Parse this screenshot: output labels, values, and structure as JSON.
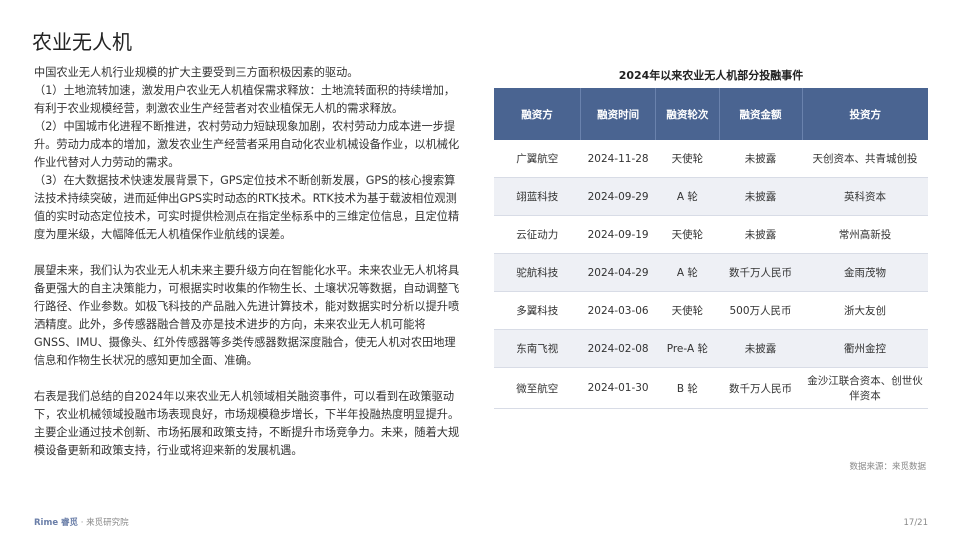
{
  "page": {
    "title": "农业无人机",
    "page_number": "17/21"
  },
  "body": {
    "intro": "中国农业无人机行业规模的扩大主要受到三方面积极因素的驱动。",
    "points": [
      "（1）土地流转加速，激发用户农业无人机植保需求释放：土地流转面积的持续增加，有利于农业规模经营，刺激农业生产经营者对农业植保无人机的需求释放。",
      "（2）中国城市化进程不断推进，农村劳动力短缺现象加剧，农村劳动力成本进一步提升。劳动力成本的增加，激发农业生产经营者采用自动化农业机械设备作业，以机械化作业代替对人力劳动的需求。",
      "（3）在大数据技术快速发展背景下，GPS定位技术不断创新发展，GPS的核心搜索算法技术持续突破，进而延伸出GPS实时动态的RTK技术。RTK技术为基于载波相位观测值的实时动态定位技术，可实时提供检测点在指定坐标系中的三维定位信息，且定位精度为厘米级，大幅降低无人机植保作业航线的误差。"
    ],
    "outlook": "展望未来，我们认为农业无人机未来主要升级方向在智能化水平。未来农业无人机将具备更强大的自主决策能力，可根据实时收集的作物生长、土壤状况等数据，自动调整飞行路径、作业参数。如极飞科技的产品融入先进计算技术，能对数据实时分析以提升喷洒精度。此外，多传感器融合普及亦是技术进步的方向，未来农业无人机可能将GNSS、IMU、摄像头、红外传感器等多类传感器数据深度融合，使无人机对农田地理信息和作物生长状况的感知更加全面、准确。",
    "summary": "右表是我们总结的自2024年以来农业无人机领域相关融资事件，可以看到在政策驱动下，农业机械领域投融市场表现良好，市场规模稳步增长，下半年投融热度明显提升。主要企业通过技术创新、市场拓展和政策支持，不断提升市场竞争力。未来，随着大规模设备更新和政策支持，行业或将迎来新的发展机遇。"
  },
  "table": {
    "title": "2024年以来农业无人机部分投融事件",
    "headers": [
      "融资方",
      "融资时间",
      "融资轮次",
      "融资金额",
      "投资方"
    ],
    "rows": [
      [
        "广翼航空",
        "2024-11-28",
        "天使轮",
        "未披露",
        "天创资本、共青城创投"
      ],
      [
        "翊蓝科技",
        "2024-09-29",
        "A 轮",
        "未披露",
        "英科资本"
      ],
      [
        "云征动力",
        "2024-09-19",
        "天使轮",
        "未披露",
        "常州高新投"
      ],
      [
        "驼航科技",
        "2024-04-29",
        "A 轮",
        "数千万人民币",
        "金雨茂物"
      ],
      [
        "多翼科技",
        "2024-03-06",
        "天使轮",
        "500万人民币",
        "浙大友创"
      ],
      [
        "东南飞视",
        "2024-02-08",
        "Pre-A 轮",
        "未披露",
        "衢州金控"
      ],
      [
        "微至航空",
        "2024-01-30",
        "B 轮",
        "数千万人民币",
        "金沙江联合资本、创世伙伴资本"
      ]
    ],
    "source": "数据来源：来觅数据"
  },
  "footer": {
    "brand": "Rime 睿觅",
    "institute": "· 来觅研究院"
  }
}
